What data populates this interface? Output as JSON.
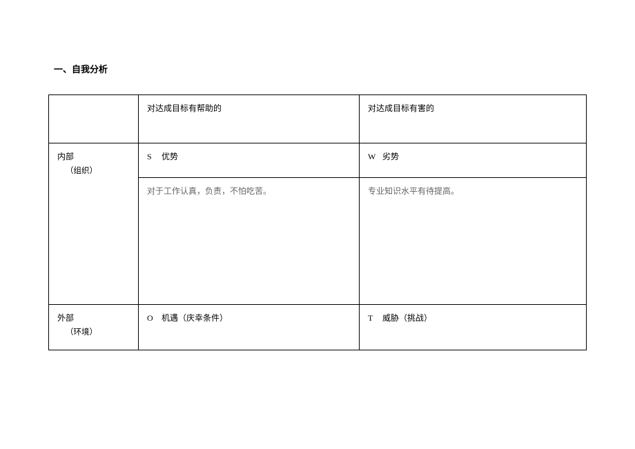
{
  "section_title": "一、自我分析",
  "headers": {
    "helpful": "对达成目标有帮助的",
    "harmful": "对达成目标有害的"
  },
  "internal": {
    "label_main": "内部",
    "label_sub": "（组织）",
    "s_letter": "S",
    "s_label": "优势",
    "w_letter": "W",
    "w_label": "劣势",
    "s_content": "对于工作认真，负责，不怕吃苦。",
    "w_content": "专业知识水平有待提高。"
  },
  "external": {
    "label_main": "外部",
    "label_sub": "（环境）",
    "o_letter": "O",
    "o_label": "机遇（庆幸条件）",
    "t_letter": "T",
    "t_label": "威胁（挑战）"
  }
}
